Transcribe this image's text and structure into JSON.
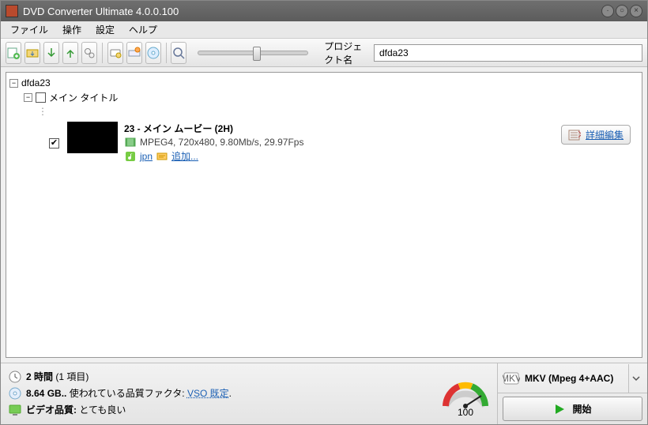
{
  "window": {
    "title": "DVD Converter Ultimate 4.0.0.100"
  },
  "menu": {
    "file": "ファイル",
    "action": "操作",
    "settings": "設定",
    "help": "ヘルプ"
  },
  "toolbar": {
    "project_label": "プロジェクト名",
    "project_value": "dfda23"
  },
  "tree": {
    "root": "dfda23",
    "main_title": "メイン タイトル",
    "item": {
      "title": "23 - メイン ムービー (2H)",
      "format": "MPEG4, 720x480, 9.80Mb/s, 29.97Fps",
      "audio_lang": "jpn",
      "add": "追加...",
      "detail_label": "詳細編集"
    }
  },
  "footer": {
    "duration_bold": "2 時間",
    "duration_rest": " (1 項目)",
    "size_bold": "8.64 GB..",
    "size_rest": " 使われている品質ファクタ: ",
    "size_link": "VSO 既定",
    "size_period": ".",
    "quality_bold": "ビデオ品質: ",
    "quality_rest": "とても良い",
    "gauge_value": "100",
    "format": "MKV (Mpeg 4+AAC)",
    "start": "開始"
  }
}
